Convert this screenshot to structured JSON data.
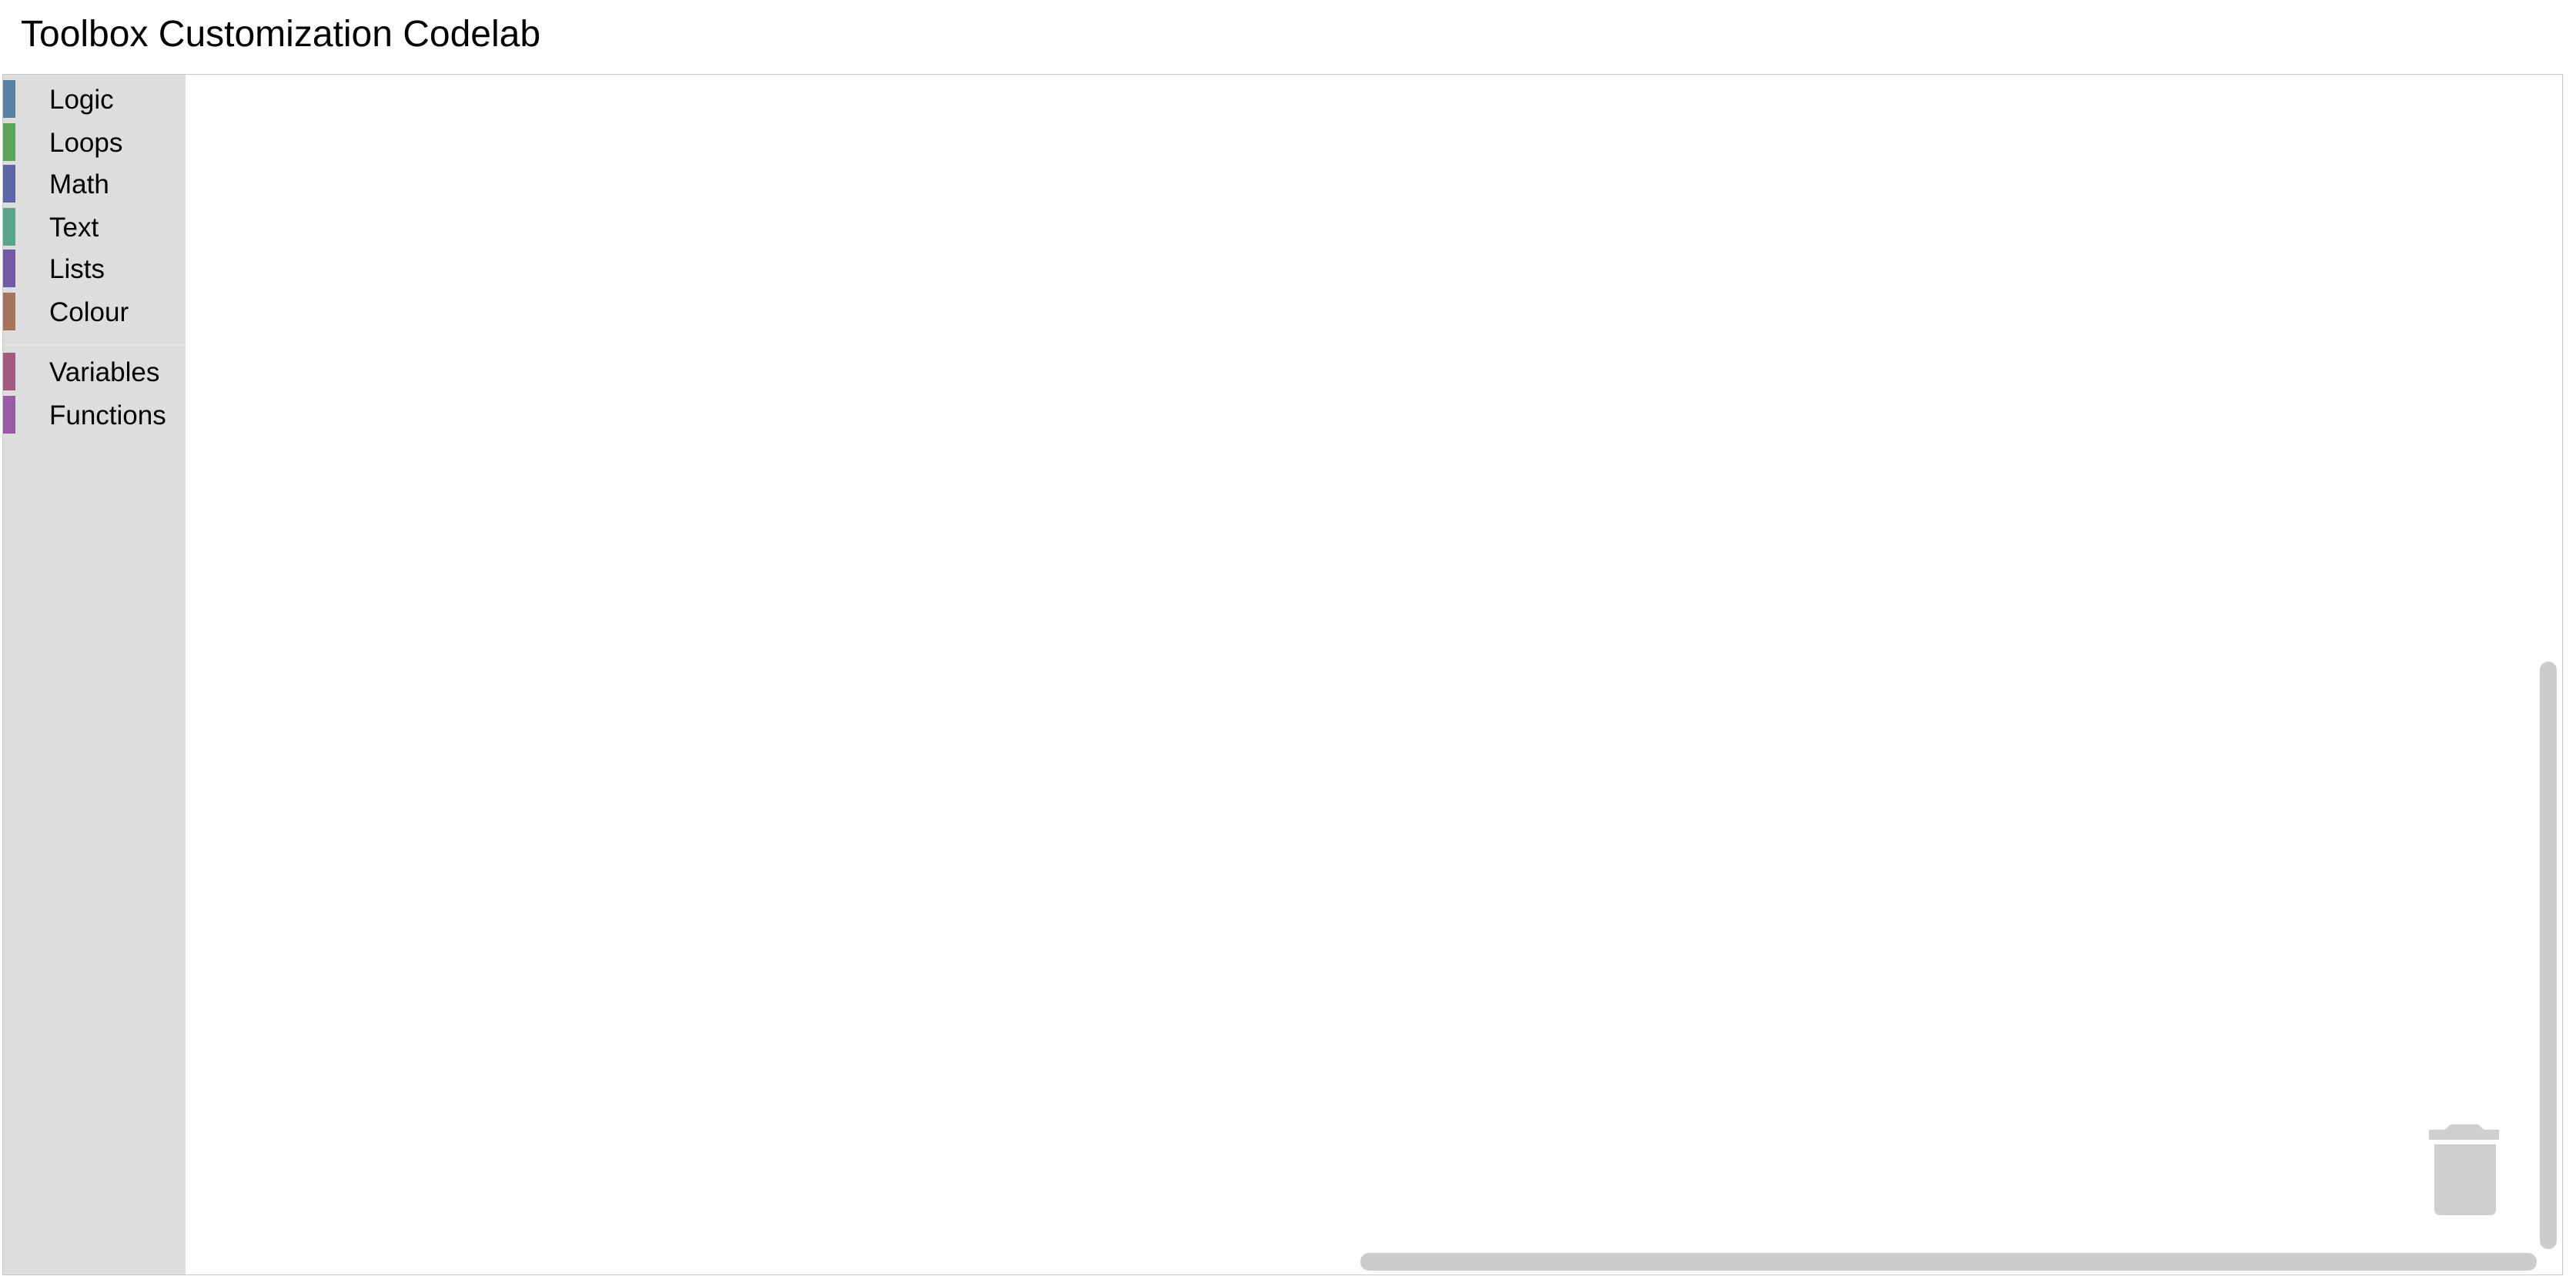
{
  "page": {
    "title": "Toolbox Customization Codelab"
  },
  "toolbox": {
    "categories": [
      {
        "label": "Logic",
        "color": "#5b80a5"
      },
      {
        "label": "Loops",
        "color": "#5ba55b"
      },
      {
        "label": "Math",
        "color": "#5b67a5"
      },
      {
        "label": "Text",
        "color": "#5ba58c"
      },
      {
        "label": "Lists",
        "color": "#745ba5"
      },
      {
        "label": "Colour",
        "color": "#a5745b"
      },
      {
        "label": "Variables",
        "color": "#a55b80"
      },
      {
        "label": "Functions",
        "color": "#995ba5"
      }
    ]
  },
  "workspace": {
    "trash_icon": "trash-can-icon"
  }
}
